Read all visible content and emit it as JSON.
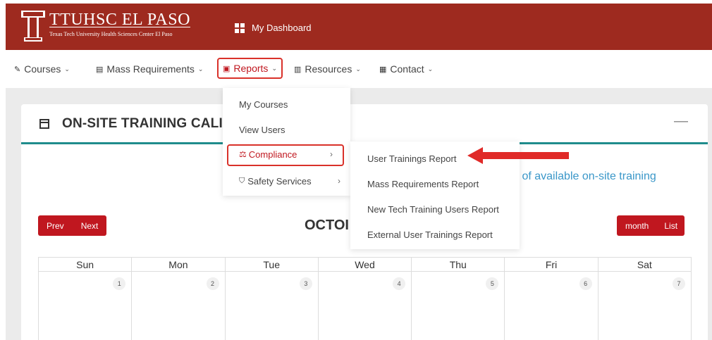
{
  "header": {
    "logo_title": "TTUHSC EL PASO",
    "logo_subtitle": "Texas Tech University Health Sciences Center El Paso",
    "dashboard_label": "My Dashboard",
    "brand_color": "#9e2a1f"
  },
  "nav": {
    "items": [
      {
        "label": "Courses",
        "icon": "book-icon"
      },
      {
        "label": "Mass Requirements",
        "icon": "clipboard-icon"
      },
      {
        "label": "Reports",
        "icon": "presentation-icon"
      },
      {
        "label": "Resources",
        "icon": "open-book-icon"
      },
      {
        "label": "Contact",
        "icon": "contact-card-icon"
      }
    ]
  },
  "card": {
    "title": "ON-SITE TRAINING CALI",
    "link_text": "ist of available on-site training",
    "accent_color": "#1f8c8c"
  },
  "calendar": {
    "prev_label": "Prev",
    "next_label": "Next",
    "month_title": "OCTOI",
    "view_month": "month",
    "view_list": "List",
    "day_headers": [
      "Sun",
      "Mon",
      "Tue",
      "Wed",
      "Thu",
      "Fri",
      "Sat"
    ],
    "first_week": [
      "1",
      "2",
      "3",
      "4",
      "5",
      "6",
      "7"
    ]
  },
  "reports_menu": {
    "items": [
      "My Courses",
      "View Users",
      "Compliance",
      "Safety Services"
    ]
  },
  "compliance_menu": {
    "items": [
      "User Trainings Report",
      "Mass Requirements Report",
      "New Tech Training Users Report",
      "External User Trainings Report"
    ]
  },
  "highlight_color": "#d9312a"
}
